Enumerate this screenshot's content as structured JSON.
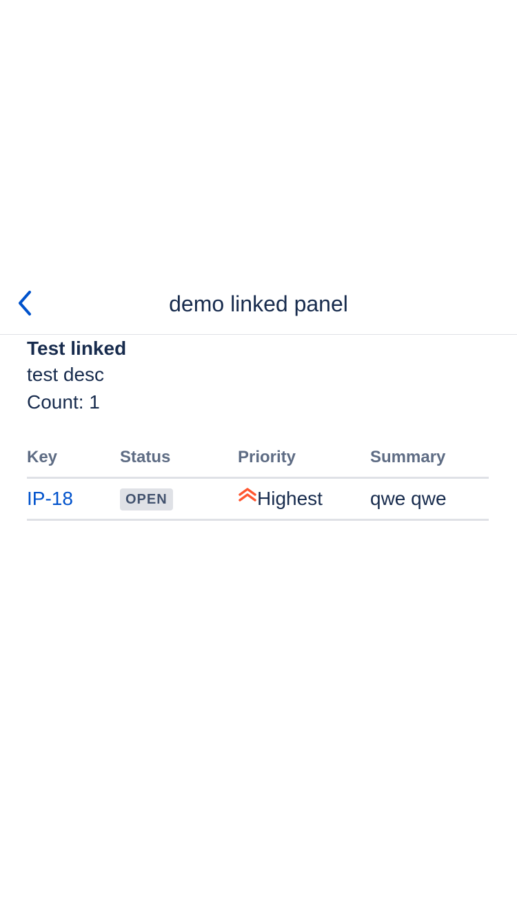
{
  "header": {
    "title": "demo linked panel",
    "back_icon": "chevron-left-icon",
    "accent_color": "#0052CC"
  },
  "panel": {
    "title": "Test linked",
    "description": "test desc",
    "count_text": "Count: 1"
  },
  "table": {
    "columns": [
      "Key",
      "Status",
      "Priority",
      "Summary"
    ],
    "rows": [
      {
        "key": "IP-18",
        "status": "OPEN",
        "priority": "Highest",
        "priority_icon": "double-chevron-up-icon",
        "priority_color": "#FF5630",
        "summary": "qwe qwe"
      }
    ]
  }
}
